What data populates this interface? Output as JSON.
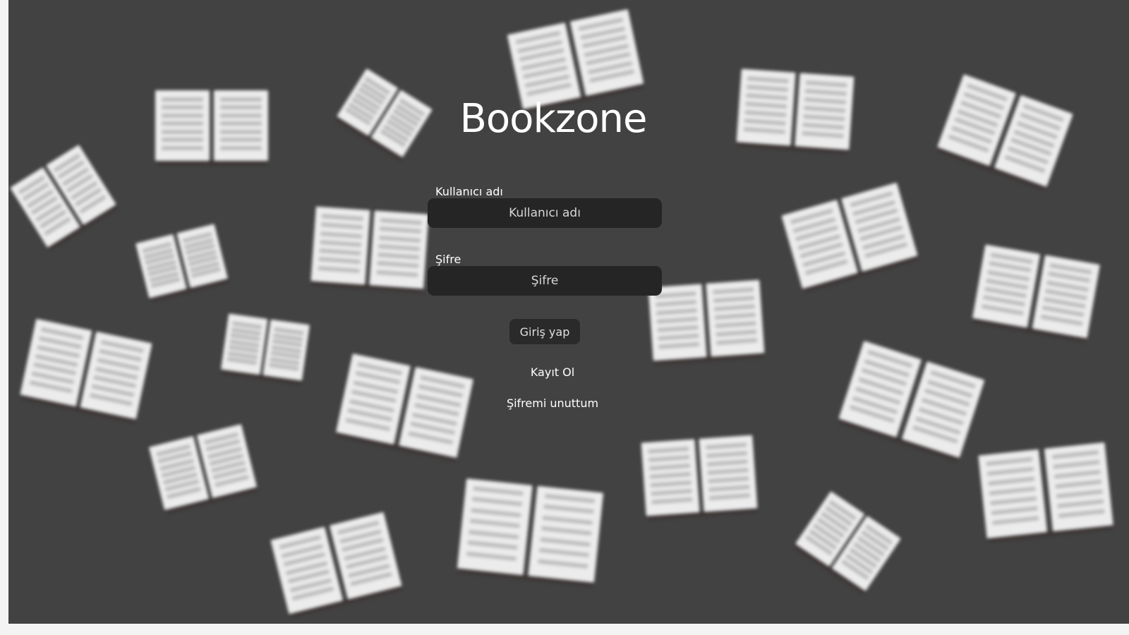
{
  "app": {
    "title": "Bookzone"
  },
  "form": {
    "username": {
      "label": "Kullanıcı adı",
      "placeholder": "Kullanıcı adı",
      "value": ""
    },
    "password": {
      "label": "Şifre",
      "placeholder": "Şifre",
      "value": ""
    },
    "login_label": "Giriş yap",
    "register_label": "Kayıt Ol",
    "forgot_label": "Şifremi unuttum"
  },
  "background": {
    "pattern_icon": "open-book-icon",
    "colors": {
      "backdrop": "#424242",
      "page": "#ececec",
      "page_lines": "#bdbdbd",
      "input_bg": "#252525",
      "button_bg": "#2a2a2a"
    }
  }
}
